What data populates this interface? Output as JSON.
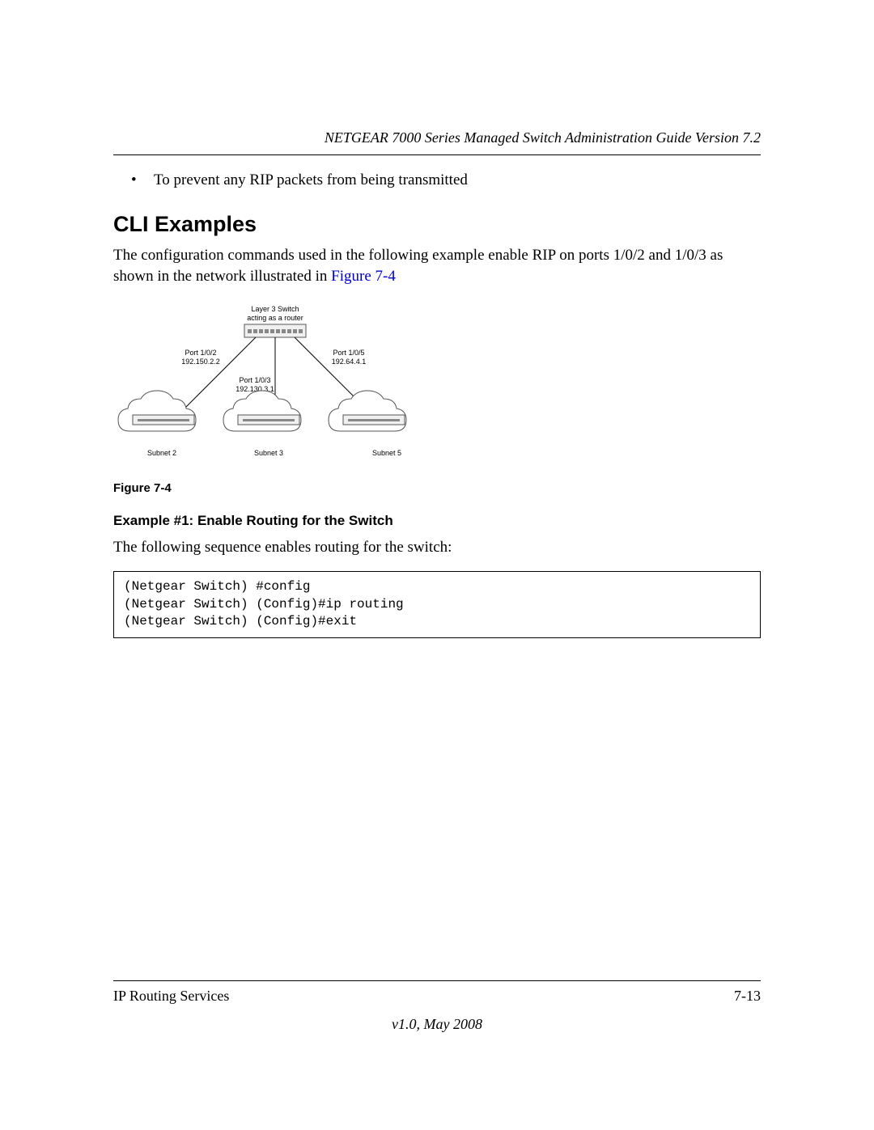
{
  "header": {
    "running": "NETGEAR 7000 Series Managed Switch Administration Guide Version 7.2"
  },
  "bullet": {
    "text": "To prevent any RIP packets from being transmitted"
  },
  "section": {
    "title": "CLI Examples",
    "intro_prefix": "The configuration commands used in the following example enable RIP on ports 1/0/2 and 1/0/3 as shown in the network illustrated in ",
    "figure_link": "Figure 7-4"
  },
  "diagram": {
    "top1": "Layer 3 Switch",
    "top2": "acting as a router",
    "port1a": "Port 1/0/2",
    "port1b": "192.150.2.2",
    "port2a": "Port 1/0/3",
    "port2b": "192.130.3.1",
    "port3a": "Port 1/0/5",
    "port3b": "192.64.4.1",
    "sub1": "Subnet 2",
    "sub2": "Subnet 3",
    "sub3": "Subnet 5"
  },
  "figure_caption": "Figure 7-4",
  "example": {
    "title": "Example #1: Enable Routing for the Switch",
    "lead": "The following sequence enables routing for the switch:",
    "code": "(Netgear Switch) #config\n(Netgear Switch) (Config)#ip routing\n(Netgear Switch) (Config)#exit"
  },
  "footer": {
    "left": "IP Routing Services",
    "right": "7-13",
    "version": "v1.0, May 2008"
  }
}
